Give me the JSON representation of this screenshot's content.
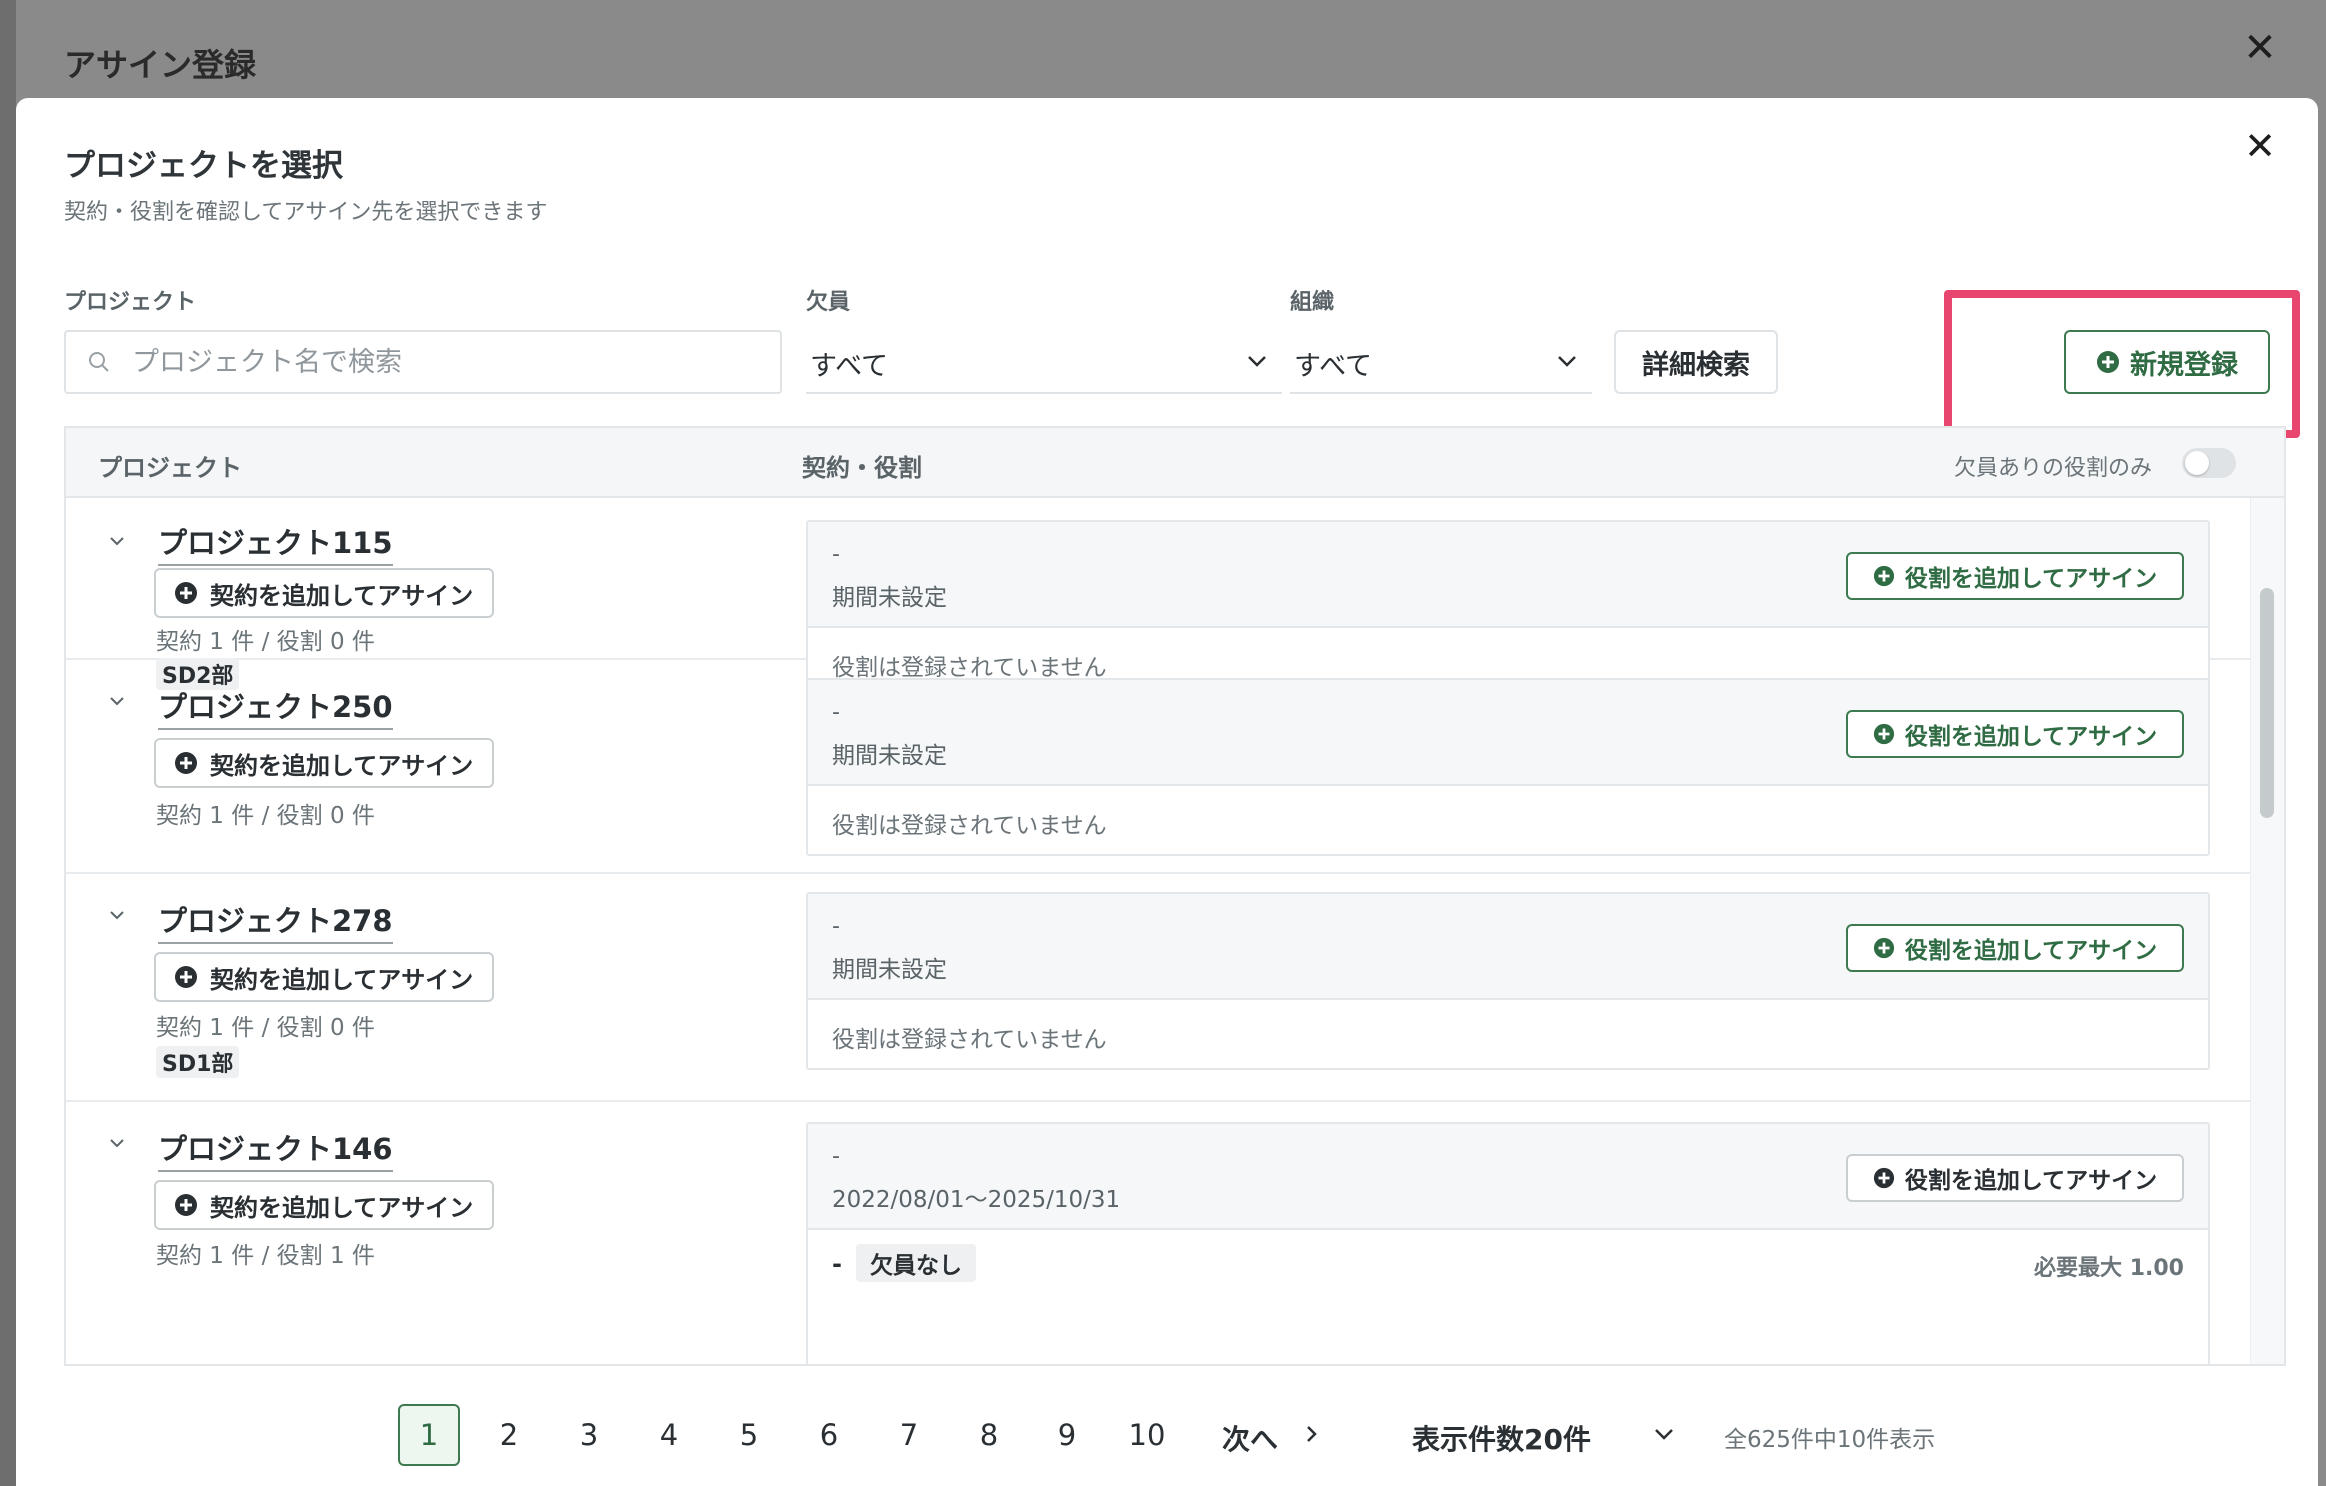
{
  "background": {
    "dialog_title": "アサイン登録"
  },
  "modal": {
    "title": "プロジェクトを選択",
    "subtitle": "契約・役割を確認してアサイン先を選択できます"
  },
  "filters": {
    "project_label": "プロジェクト",
    "search_placeholder": "プロジェクト名で検索",
    "vacancy_label": "欠員",
    "vacancy_value": "すべて",
    "org_label": "組織",
    "org_value": "すべて",
    "detail_search": "詳細検索",
    "new_register": "新規登録"
  },
  "table": {
    "col_project": "プロジェクト",
    "col_contract": "契約・役割",
    "toggle_label": "欠員ありの役割のみ",
    "toggle_on": false,
    "add_contract_label": "契約を追加してアサイン",
    "add_role_label": "役割を追加してアサイン",
    "rows": [
      {
        "name": "プロジェクト115",
        "stats": "契約 1 件 / 役割 0 件",
        "tag": "SD2部",
        "contract_name": "-",
        "period": "期間未設定",
        "empty": "役割は登録されていません"
      },
      {
        "name": "プロジェクト250",
        "stats": "契約 1 件 / 役割 0 件",
        "tag": "",
        "contract_name": "-",
        "period": "期間未設定",
        "empty": "役割は登録されていません"
      },
      {
        "name": "プロジェクト278",
        "stats": "契約 1 件 / 役割 0 件",
        "tag": "SD1部",
        "contract_name": "-",
        "period": "期間未設定",
        "empty": "役割は登録されていません"
      },
      {
        "name": "プロジェクト146",
        "stats": "契約 1 件 / 役割 1 件",
        "tag": "",
        "contract_name": "-",
        "period": "2022/08/01〜2025/10/31",
        "role_dash": "-",
        "role_badge": "欠員なし",
        "role_req": "必要最大 1.00"
      }
    ]
  },
  "pagination": {
    "pages": [
      "1",
      "2",
      "3",
      "4",
      "5",
      "6",
      "7",
      "8",
      "9",
      "10"
    ],
    "current": "1",
    "next": "次へ",
    "per_page": "表示件数20件",
    "total": "全625件中10件表示"
  },
  "colors": {
    "accent_green": "#2f6b43",
    "highlight_pink": "#e8466e"
  }
}
